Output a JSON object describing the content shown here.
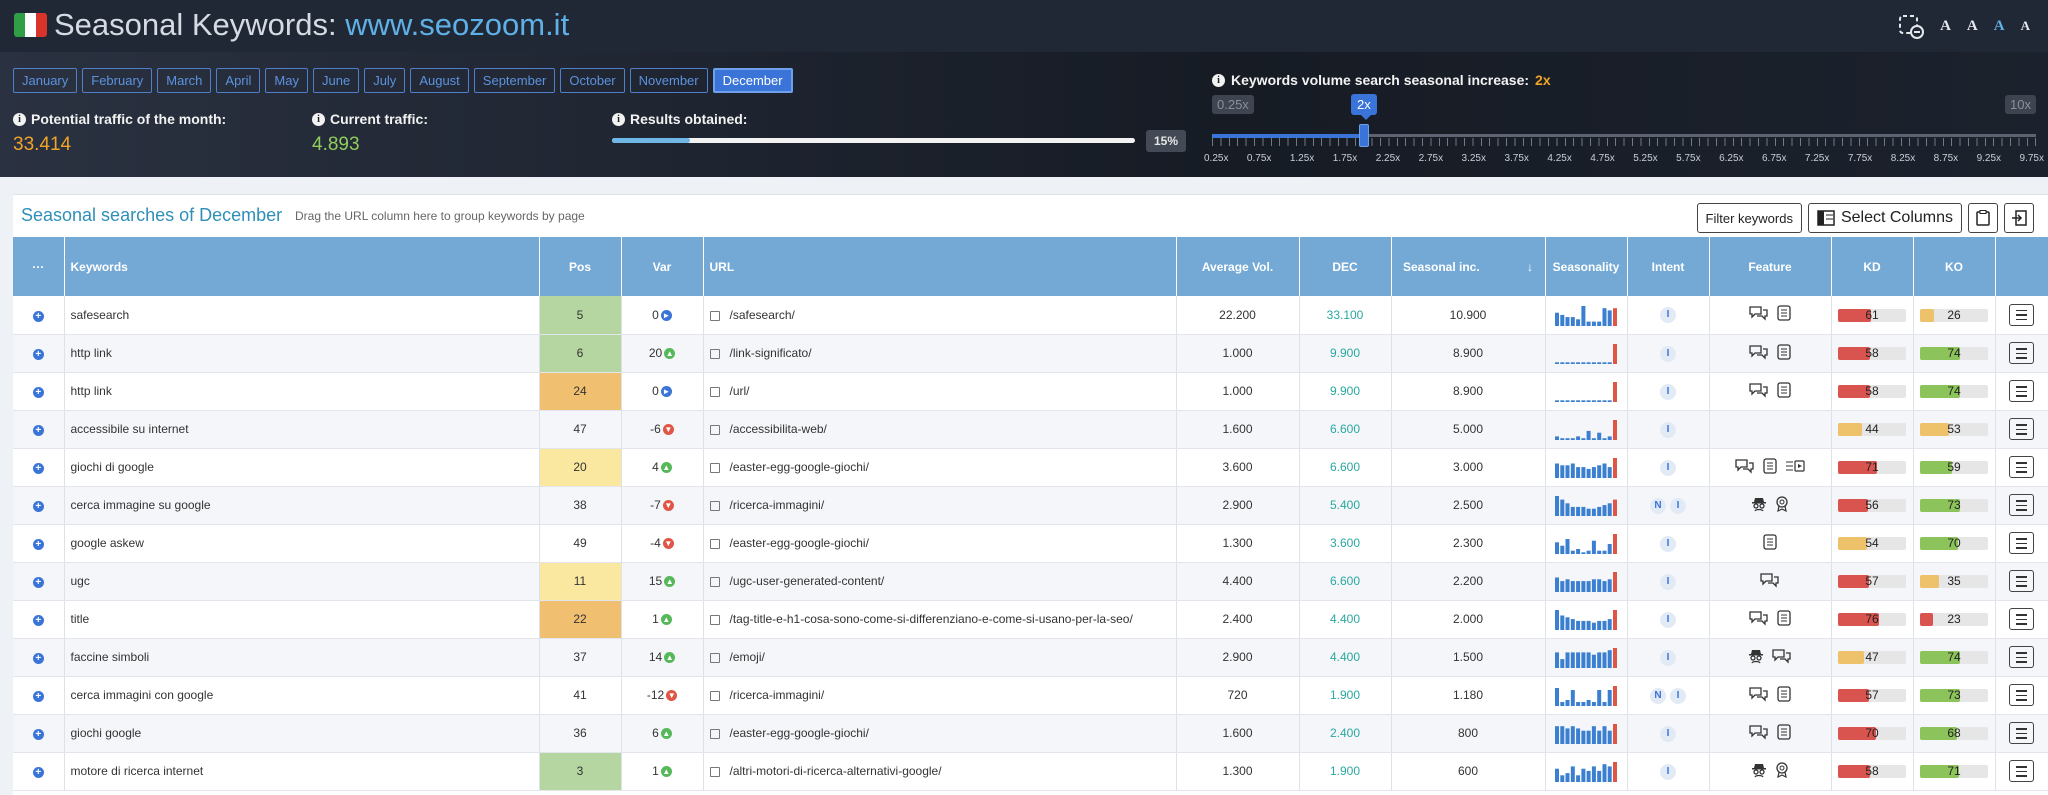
{
  "header": {
    "title_prefix": "Seasonal Keywords: ",
    "title_domain": "www.seozoom.it",
    "flag_colors": [
      "#2f9e44",
      "#ffffff",
      "#d9342b"
    ],
    "font_sizes": [
      "A",
      "A",
      "A",
      "A"
    ]
  },
  "months": [
    "January",
    "February",
    "March",
    "April",
    "May",
    "June",
    "July",
    "August",
    "September",
    "October",
    "November",
    "December"
  ],
  "active_month": "December",
  "stats": {
    "potential_label": "Potential traffic of the month:",
    "potential_value": "33.414",
    "current_label": "Current traffic:",
    "current_value": "4.893",
    "results_label": "Results obtained:",
    "results_pct_text": "15%",
    "results_fraction": 0.15
  },
  "seasonal": {
    "label": "Keywords volume search seasonal increase:",
    "multiplier": "2x",
    "min": "0.25x",
    "max": "10x",
    "current": "2x",
    "tick_labels": [
      "0.25x",
      "0.75x",
      "1.25x",
      "1.75x",
      "2.25x",
      "2.75x",
      "3.25x",
      "3.75x",
      "4.25x",
      "4.75x",
      "5.25x",
      "5.75x",
      "6.25x",
      "6.75x",
      "7.25x",
      "7.75x",
      "8.25x",
      "8.75x",
      "9.25x",
      "9.75x"
    ]
  },
  "card": {
    "title": "Seasonal searches of December",
    "hint": "Drag the URL column here to group keywords by page",
    "filter_button": "Filter keywords",
    "columns_button": "Select Columns"
  },
  "table": {
    "headers": {
      "more": "···",
      "keywords": "Keywords",
      "pos": "Pos",
      "var": "Var",
      "url": "URL",
      "avg": "Average Vol.",
      "dec": "DEC",
      "seasonal": "Seasonal inc.",
      "seasonality": "Seasonality",
      "intent": "Intent",
      "feature": "Feature",
      "kd": "KD",
      "ko": "KO"
    },
    "rows": [
      {
        "kw": "safesearch",
        "pos": "5",
        "poscolor": "#b5d6a0",
        "var": "0",
        "dir": "flat",
        "url": "/safesearch/",
        "avg": "22.200",
        "dec": "33.100",
        "inc": "10.900",
        "spark": [
          6,
          5,
          4,
          4,
          3,
          9,
          2,
          2,
          2,
          8,
          7,
          8
        ],
        "intent": [
          "I"
        ],
        "feat": [
          "chat",
          "list"
        ],
        "kd": 61,
        "kdcolor": "#d9534f",
        "ko": 26,
        "kocolor": "#eec26a"
      },
      {
        "kw": "http link",
        "pos": "6",
        "poscolor": "#b5d6a0",
        "var": "20",
        "dir": "up",
        "url": "/link-significato/",
        "avg": "1.000",
        "dec": "9.900",
        "inc": "8.900",
        "spark": [
          1,
          1,
          1,
          1,
          1,
          1,
          1,
          1,
          1,
          1,
          1,
          12
        ],
        "intent": [
          "I"
        ],
        "feat": [
          "chat",
          "list"
        ],
        "kd": 58,
        "kdcolor": "#d9534f",
        "ko": 74,
        "kocolor": "#8cc35a"
      },
      {
        "kw": "http link",
        "pos": "24",
        "poscolor": "#f0c070",
        "var": "0",
        "dir": "flat",
        "url": "/url/",
        "avg": "1.000",
        "dec": "9.900",
        "inc": "8.900",
        "spark": [
          1,
          1,
          1,
          1,
          1,
          1,
          1,
          1,
          1,
          1,
          1,
          12
        ],
        "intent": [
          "I"
        ],
        "feat": [
          "chat",
          "list"
        ],
        "kd": 58,
        "kdcolor": "#d9534f",
        "ko": 74,
        "kocolor": "#8cc35a"
      },
      {
        "kw": "accessibile su internet",
        "pos": "47",
        "poscolor": "",
        "var": "-6",
        "dir": "down",
        "url": "/accessibilita-web/",
        "avg": "1.600",
        "dec": "6.600",
        "inc": "5.000",
        "spark": [
          2,
          1,
          1,
          1,
          2,
          1,
          5,
          1,
          4,
          1,
          2,
          11
        ],
        "intent": [
          "I"
        ],
        "feat": [],
        "kd": 44,
        "kdcolor": "#eec26a",
        "ko": 53,
        "kocolor": "#eec26a"
      },
      {
        "kw": "giochi di google",
        "pos": "20",
        "poscolor": "#fbe8a0",
        "var": "4",
        "dir": "up",
        "url": "/easter-egg-google-giochi/",
        "avg": "3.600",
        "dec": "6.600",
        "inc": "3.000",
        "spark": [
          8,
          7,
          7,
          8,
          6,
          6,
          5,
          6,
          7,
          8,
          6,
          11
        ],
        "intent": [
          "I"
        ],
        "feat": [
          "chat",
          "list",
          "video"
        ],
        "kd": 71,
        "kdcolor": "#d9534f",
        "ko": 59,
        "kocolor": "#8cc35a"
      },
      {
        "kw": "cerca immagine su google",
        "pos": "38",
        "poscolor": "",
        "var": "-7",
        "dir": "down",
        "url": "/ricerca-immagini/",
        "avg": "2.900",
        "dec": "5.400",
        "inc": "2.500",
        "spark": [
          11,
          9,
          7,
          5,
          5,
          5,
          4,
          4,
          5,
          6,
          7,
          9
        ],
        "intent": [
          "N",
          "I"
        ],
        "feat": [
          "spy",
          "award"
        ],
        "kd": 56,
        "kdcolor": "#d9534f",
        "ko": 73,
        "kocolor": "#8cc35a"
      },
      {
        "kw": "google askew",
        "pos": "49",
        "poscolor": "",
        "var": "-4",
        "dir": "down",
        "url": "/easter-egg-google-giochi/",
        "avg": "1.300",
        "dec": "3.600",
        "inc": "2.300",
        "spark": [
          7,
          5,
          9,
          2,
          3,
          1,
          2,
          8,
          2,
          2,
          6,
          12
        ],
        "intent": [
          "I"
        ],
        "feat": [
          "list"
        ],
        "kd": 54,
        "kdcolor": "#eec26a",
        "ko": 70,
        "kocolor": "#8cc35a"
      },
      {
        "kw": "ugc",
        "pos": "11",
        "poscolor": "#fbe8a0",
        "var": "15",
        "dir": "up",
        "url": "/ugc-user-generated-content/",
        "avg": "4.400",
        "dec": "6.600",
        "inc": "2.200",
        "spark": [
          8,
          6,
          7,
          6,
          6,
          6,
          6,
          7,
          7,
          6,
          7,
          11
        ],
        "intent": [
          "I"
        ],
        "feat": [
          "chat"
        ],
        "kd": 57,
        "kdcolor": "#d9534f",
        "ko": 35,
        "kocolor": "#eec26a"
      },
      {
        "kw": "title",
        "pos": "22",
        "poscolor": "#f0c070",
        "var": "1",
        "dir": "up",
        "url": "/tag-title-e-h1-cosa-sono-come-si-differenziano-e-come-si-usano-per-la-seo/",
        "avg": "2.400",
        "dec": "4.400",
        "inc": "2.000",
        "spark": [
          11,
          8,
          7,
          6,
          5,
          5,
          5,
          4,
          5,
          5,
          6,
          11
        ],
        "intent": [
          "I"
        ],
        "feat": [
          "chat",
          "list"
        ],
        "kd": 76,
        "kdcolor": "#d9534f",
        "ko": 23,
        "kocolor": "#d9534f"
      },
      {
        "kw": "faccine simboli",
        "pos": "37",
        "poscolor": "",
        "var": "14",
        "dir": "up",
        "url": "/emoji/",
        "avg": "2.900",
        "dec": "4.400",
        "inc": "1.500",
        "spark": [
          7,
          4,
          7,
          7,
          7,
          7,
          7,
          6,
          7,
          7,
          8,
          9
        ],
        "intent": [
          "I"
        ],
        "feat": [
          "spy",
          "chat"
        ],
        "kd": 47,
        "kdcolor": "#eec26a",
        "ko": 74,
        "kocolor": "#8cc35a"
      },
      {
        "kw": "cerca immagini con google",
        "pos": "41",
        "poscolor": "",
        "var": "-12",
        "dir": "down",
        "url": "/ricerca-immagini/",
        "avg": "720",
        "dec": "1.900",
        "inc": "1.180",
        "spark": [
          9,
          2,
          3,
          8,
          2,
          2,
          3,
          2,
          8,
          2,
          8,
          10
        ],
        "intent": [
          "N",
          "I"
        ],
        "feat": [
          "chat",
          "list"
        ],
        "kd": 57,
        "kdcolor": "#d9534f",
        "ko": 73,
        "kocolor": "#8cc35a"
      },
      {
        "kw": "giochi google",
        "pos": "36",
        "poscolor": "",
        "var": "6",
        "dir": "up",
        "url": "/easter-egg-google-giochi/",
        "avg": "1.600",
        "dec": "2.400",
        "inc": "800",
        "spark": [
          8,
          8,
          7,
          8,
          7,
          6,
          6,
          8,
          6,
          8,
          6,
          9
        ],
        "intent": [
          "I"
        ],
        "feat": [
          "chat",
          "list"
        ],
        "kd": 70,
        "kdcolor": "#d9534f",
        "ko": 68,
        "kocolor": "#8cc35a"
      },
      {
        "kw": "motore di ricerca internet",
        "pos": "3",
        "poscolor": "#b5d6a0",
        "var": "1",
        "dir": "up",
        "url": "/altri-motori-di-ricerca-alternativi-google/",
        "avg": "1.300",
        "dec": "1.900",
        "inc": "600",
        "spark": [
          6,
          3,
          4,
          7,
          3,
          6,
          5,
          7,
          5,
          8,
          7,
          9
        ],
        "intent": [
          "I"
        ],
        "feat": [
          "spy",
          "award"
        ],
        "kd": 58,
        "kdcolor": "#d9534f",
        "ko": 71,
        "kocolor": "#8cc35a"
      }
    ]
  }
}
